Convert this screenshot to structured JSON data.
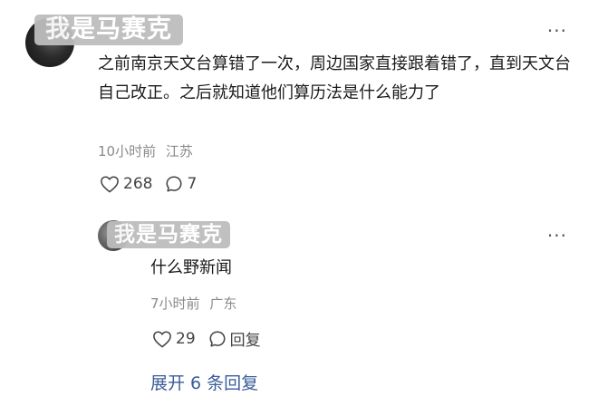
{
  "comment": {
    "username": "我是马赛克",
    "text": "之前南京天文台算错了一次，周边国家直接跟着错了，直到天文台自己改正。之后就知道他们算历法是什么能力了",
    "time": "10小时前",
    "location": "江苏",
    "likes": "268",
    "replies_count": "7",
    "more": "···"
  },
  "reply": {
    "username": "我是马赛克",
    "text": "什么野新闻",
    "time": "7小时前",
    "location": "广东",
    "likes": "29",
    "reply_label": "回复",
    "more": "···"
  },
  "expand_label": "展开 6 条回复"
}
